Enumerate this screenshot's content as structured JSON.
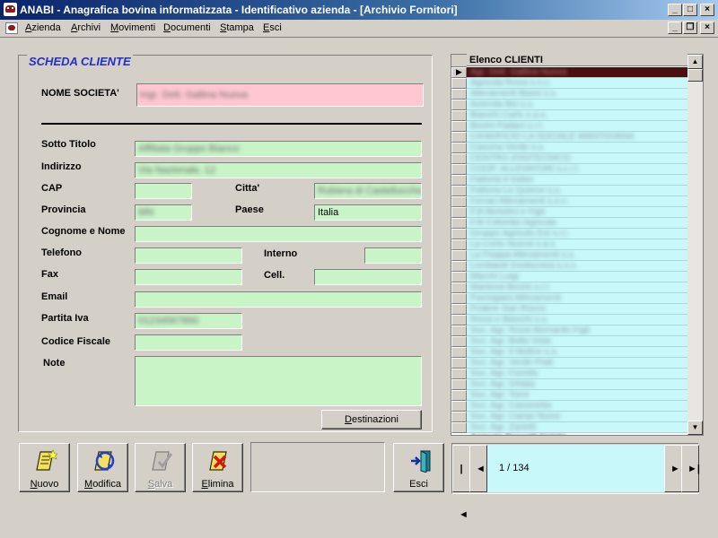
{
  "window": {
    "title": "ANABI - Anagrafica bovina informatizzata - Identificativo azienda - [Archivio Fornitori]"
  },
  "menu": [
    {
      "label": "Azienda",
      "key": "A",
      "rest": "zienda"
    },
    {
      "label": "Archivi",
      "key": "A",
      "rest": "rchivi"
    },
    {
      "label": "Movimenti",
      "key": "M",
      "rest": "ovimenti"
    },
    {
      "label": "Documenti",
      "key": "D",
      "rest": "ocumenti"
    },
    {
      "label": "Stampa",
      "key": "S",
      "rest": "tampa"
    },
    {
      "label": "Esci",
      "key": "E",
      "rest": "sci"
    }
  ],
  "form": {
    "title": "SCHEDA CLIENTE",
    "labels": {
      "nome_societa": "NOME SOCIETA'",
      "sotto_titolo": "Sotto Titolo",
      "indirizzo": "Indirizzo",
      "cap": "CAP",
      "citta": "Citta'",
      "provincia": "Provincia",
      "paese": "Paese",
      "cognome_nome": "Cognome e Nome",
      "telefono": "Telefono",
      "interno": "Interno",
      "fax": "Fax",
      "cell": "Cell.",
      "email": "Email",
      "partita_iva": "Partita Iva",
      "codice_fiscale": "Codice Fiscale",
      "note": "Note"
    },
    "values": {
      "nome_societa": "Ingr. Dott. Gallina Nuova",
      "sotto_titolo": "Affiliata Gruppo Bianco",
      "indirizzo": "Via Nazionale, 12",
      "cap": "",
      "citta": "Rubiera di Castellucchio",
      "provincia": "MN",
      "paese": "Italia",
      "cognome_nome": "",
      "telefono": "",
      "interno": "",
      "fax": "",
      "cell": "",
      "email": "",
      "partita_iva": "01234567890",
      "codice_fiscale": "",
      "note": ""
    },
    "destinazioni_key": "D",
    "destinazioni_rest": "estinazioni"
  },
  "list": {
    "header": "Elenco CLIENTI",
    "rows": [
      "Agr. Dott. Gallina Nuova",
      "Agricola Rossi s.n.c.",
      "Allevamenti Bassi s.s.",
      "Azienda Bio s.s.",
      "Bianchi Carlo s.a.s.",
      "Bovini Padani s.r.l.",
      "CASEIFICIO LA SOCIALE MANTOVANA",
      "Cascina Verde s.s.",
      "CENTRO ZOOTECNICO",
      "COOP. ALLEVATORI s.c.r.l.",
      "Fattoria Il Gelso",
      "Fattoria Le Querce s.s.",
      "Ferrari Allevamenti s.n.c.",
      "F.lli Bertolini e Figli",
      "F.lli Colombo Agricola",
      "Gruppo Agricolo Est s.r.l.",
      "La Corte Nuova s.a.s.",
      "La Pioppa Allevamenti s.s.",
      "Lombardi Zootecnica s.n.c.",
      "Marchi Luigi",
      "Mantova Bovini s.r.l.",
      "Parmigiani Allevamenti",
      "Podere San Rocco",
      "Rossi e Bianchi s.s.",
      "Soc. Agr. Rossi Bernardo Figli",
      "Soc. Agr. Bella Vista",
      "Soc. Agr. Il Mulino s.s.",
      "Soc. Agr. Verde Prati",
      "Soc. Agr. Fiorello",
      "Soc. Agr. Ghiaia",
      "Soc. Agr. Torre",
      "Soc. Agr. Cassinetta",
      "Soc. Agr. Campi Nuovi",
      "Soc. Agr. Zanetti"
    ],
    "partial_row": "Agricola Rossetti Natale"
  },
  "toolbar": {
    "nuovo_key": "N",
    "nuovo_rest": "uovo",
    "modifica_key": "M",
    "modifica_rest": "odifica",
    "salva_key": "S",
    "salva_rest": "alva",
    "elimina_key": "E",
    "elimina_rest": "limina",
    "esci_label": "Esci"
  },
  "navigator": {
    "first": "|◄",
    "prev": "◄",
    "next": "►",
    "last": "►|",
    "record": "1 / 134"
  },
  "icons": {
    "app": "cow-icon",
    "nuovo": "new-doc-icon",
    "modifica": "edit-doc-icon",
    "salva": "save-doc-icon",
    "elimina": "delete-doc-icon",
    "esci": "exit-door-icon"
  }
}
